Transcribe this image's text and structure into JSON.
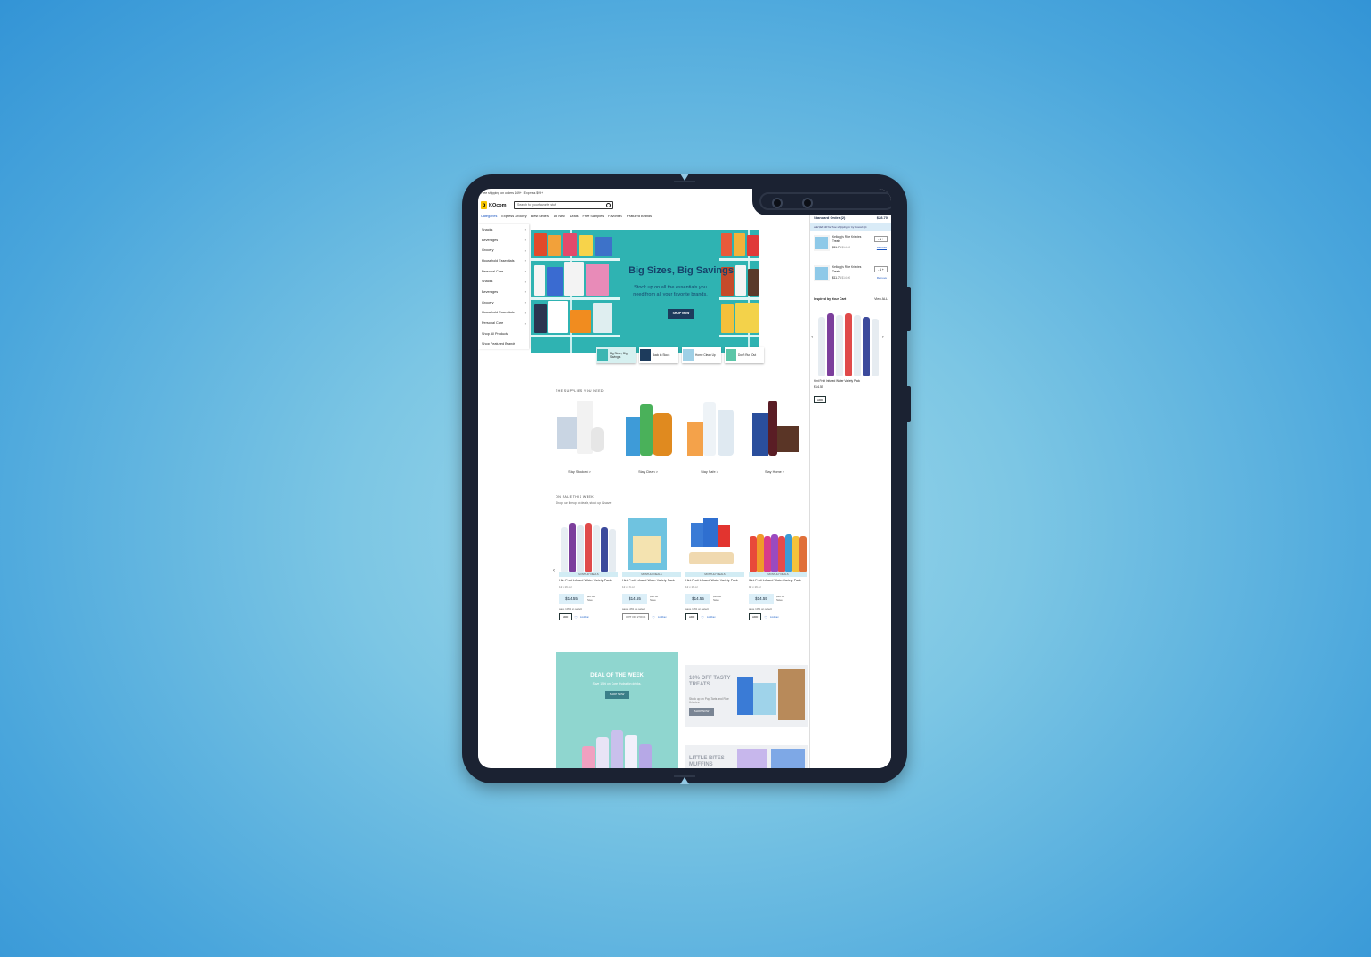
{
  "site": {
    "promo_bar": "Free shipping on orders $49+ | Express $99+",
    "logo_text": "KOcom",
    "search_placeholder": "Search for your favorite stuff"
  },
  "nav": {
    "items": [
      "Categories",
      "Express Grocery",
      "Best Sellers",
      "All New",
      "Deals",
      "Free Samples",
      "Favorites",
      "Featured Brands"
    ]
  },
  "sidebar": {
    "items": [
      {
        "label": "Snacks"
      },
      {
        "label": "Beverages"
      },
      {
        "label": "Grocery"
      },
      {
        "label": "Household Essentials"
      },
      {
        "label": "Personal Care"
      },
      {
        "label": "Snacks"
      },
      {
        "label": "Beverages"
      },
      {
        "label": "Grocery"
      },
      {
        "label": "Household Essentials"
      },
      {
        "label": "Personal Care"
      },
      {
        "label": "Shop All Products"
      },
      {
        "label": "Shop Featured Brands"
      }
    ]
  },
  "hero": {
    "title": "Big Sizes, Big Savings",
    "subtitle": "Stock up on all the essentials you need from all your favorite brands.",
    "button": "SHOP NOW",
    "colors": {
      "bg": "#2fb3b2",
      "text": "#16416a"
    }
  },
  "hero_thumbs": [
    {
      "label": "Big Sizes, Big Savings"
    },
    {
      "label": "Back in Stock"
    },
    {
      "label": "Home Clean Up"
    },
    {
      "label": "Don't Run Out"
    }
  ],
  "supplies": {
    "title": "THE SUPPLIES YOU NEED",
    "items": [
      {
        "label": "Stay Stocked >"
      },
      {
        "label": "Stay Clean >"
      },
      {
        "label": "Stay Safe >"
      },
      {
        "label": "Stay Home >"
      }
    ]
  },
  "sale": {
    "title": "ON SALE THIS WEEK",
    "subtitle": "Shop our lineup of deals, stock up & save",
    "cards": [
      {
        "badge": "MONTHLY DEALS",
        "name": "Hint Fruit Infused Water Variety Pack",
        "sub": "12 x 16 oz",
        "price": "$14.55",
        "was": "$18.00",
        "save": "Save",
        "note": "save 10% on select",
        "action": "ADD",
        "fav": "ListFav"
      },
      {
        "badge": "MONTHLY DEALS",
        "name": "Hint Fruit Infused Water Variety Pack",
        "sub": "12 x 16 oz",
        "price": "$14.55",
        "was": "$18.00",
        "save": "Save",
        "note": "save 10% on select",
        "action": "OUT OF STOCK",
        "fav": "ListFav"
      },
      {
        "badge": "MONTHLY DEALS",
        "name": "Hint Fruit Infused Water Variety Pack",
        "sub": "12 x 16 oz",
        "price": "$14.55",
        "was": "$18.00",
        "save": "Save",
        "note": "save 10% on select",
        "action": "ADD",
        "fav": "ListFav"
      },
      {
        "badge": "MONTHLY DEALS",
        "name": "Hint Fruit Infused Water Variety Pack",
        "sub": "12 x 16 oz",
        "price": "$14.55",
        "was": "$18.00",
        "save": "Save",
        "note": "save 10% on select",
        "action": "ADD",
        "fav": "ListFav"
      }
    ]
  },
  "deal": {
    "title": "DEAL OF THE WEEK",
    "subtitle": "Save 15% on Core Hydration drinks.",
    "button": "SHOP NOW"
  },
  "promos": [
    {
      "title": "10% OFF TASTY TREATS",
      "subtitle": "Stock up on Pop-Tarts and Rice Krispies.",
      "button": "SHOP NOW"
    },
    {
      "title": "LITTLE BITES MUFFINS",
      "subtitle": "",
      "button": ""
    }
  ],
  "cart": {
    "title": "Standard Order (2)",
    "total": "$28.70",
    "note": "Add $20.30 for free shipping or try Boxed Up",
    "items": [
      {
        "name": "Kellogg's Rice Krispies Treats",
        "price": "$11.73",
        "was": "$14.00",
        "qty": "- 1 +",
        "remove": "Remove"
      },
      {
        "name": "Kellogg's Rice Krispies Treats",
        "price": "$11.73",
        "was": "$14.00",
        "qty": "- 1 +",
        "remove": "Remove"
      }
    ],
    "inspired_title": "Inspired by Your Cart",
    "inspired_link": "View ALL",
    "inspired_item": {
      "name": "Hint Fruit Infused Water Variety Pack",
      "price": "$14.55",
      "action": "ADD"
    }
  }
}
